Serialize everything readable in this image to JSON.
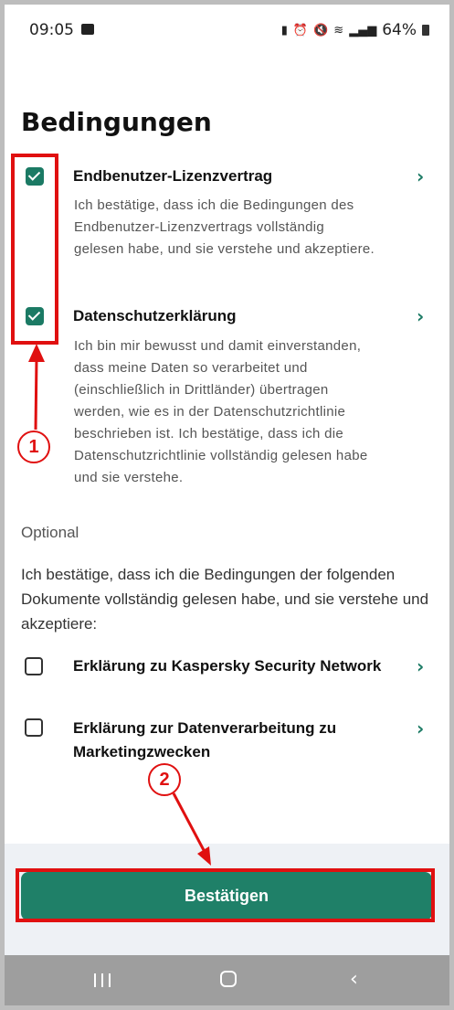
{
  "status": {
    "time": "09:05",
    "battery": "64%"
  },
  "page_title": "Bedingungen",
  "items": [
    {
      "title": "Endbenutzer-Lizenzvertrag",
      "description": "Ich bestätige, dass ich die Bedingungen des Endbenutzer-Lizenzvertrags vollständig gelesen habe, und sie verstehe und akzeptiere.",
      "checked": true
    },
    {
      "title": "Datenschutzerklärung",
      "description": "Ich bin mir bewusst und damit einverstanden, dass meine Daten so verarbeitet und (einschließlich in Drittländer) übertragen werden, wie es in der Datenschutzrichtlinie beschrieben ist. Ich bestätige, dass ich die Datenschutzrichtlinie vollständig gelesen habe und sie verstehe.",
      "checked": true
    }
  ],
  "optional": {
    "label": "Optional",
    "text": "Ich bestätige, dass ich die Bedingungen der folgenden Dokumente vollständig gelesen habe, und sie verstehe und akzeptiere:",
    "items": [
      {
        "title": "Erklärung zu Kaspersky Security Network",
        "checked": false
      },
      {
        "title": "Erklärung zur Datenverarbeitung zu Marketingzwecken",
        "checked": false
      }
    ]
  },
  "confirm_label": "Bestätigen",
  "annotations": {
    "marker_1": "1",
    "marker_2": "2"
  },
  "colors": {
    "accent": "#1b7a64",
    "button": "#1f8068",
    "annotation": "#e01010"
  }
}
